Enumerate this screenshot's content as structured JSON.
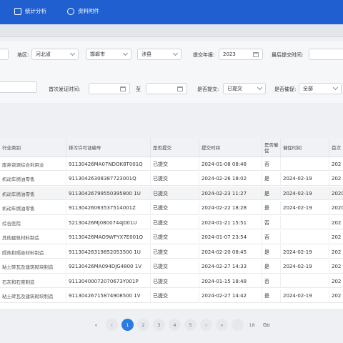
{
  "nav": [
    {
      "label": "统计分析",
      "icon": "chart-icon"
    },
    {
      "label": "资料附件",
      "icon": "attachment-icon"
    }
  ],
  "filters": {
    "region_label": "地区:",
    "province": "河北省",
    "city": "邯郸市",
    "county": "涉县",
    "submit_year_label": "提交年报:",
    "submit_year": "2023",
    "last_submit_label": "最后提交时间:",
    "issue_date_label": "首次发证时间:",
    "to_label": "至",
    "submitted_label": "是否提交:",
    "submitted_value": "已提交",
    "urged_label": "是否催促:",
    "urged_value": "全部"
  },
  "table": {
    "headers": [
      "行业类别",
      "排污许可证编号",
      "是否提交",
      "提交时间",
      "是否催促",
      "催促时间",
      "首次"
    ],
    "rows": [
      [
        "废弃资源综合利用业",
        "91130426MA07NDOK8T001Q",
        "已提交",
        "2024-01-08 08:48",
        "否",
        "",
        "202"
      ],
      [
        "机动车燃油零售",
        "91130426308387723001Q",
        "已提交",
        "2024-02-26 18:02",
        "是",
        "2024-02-19",
        "202"
      ],
      [
        "机动车燃油零售",
        "91130426799550395800 1U",
        "已提交",
        "2024-02-23 11:27",
        "是",
        "2024-02-19",
        "2020"
      ],
      [
        "机动车燃油零售",
        "91130426063537514001Z",
        "已提交",
        "2024-02-22 18:28",
        "是",
        "2024-02-19",
        "2020"
      ],
      [
        "综合医院",
        "52130426MJ0800744J001U",
        "已提交",
        "2024-01-21 15:51",
        "否",
        "",
        "202"
      ],
      [
        "其他建筑材料制造",
        "91130426MAO9WFYX7E001Q",
        "已提交",
        "2024-01-07 23:54",
        "否",
        "",
        "202"
      ],
      [
        "隔热和隔音材料制造",
        "91130426319852053500 1U",
        "已提交",
        "2024-02-20 08:45",
        "是",
        "2024-02-19",
        "202"
      ],
      [
        "粘土砖瓦及建筑砌块制造",
        "92130426MA094DJG4800 1V",
        "已提交",
        "2024-02-27 14:33",
        "是",
        "2024-02-19",
        "202"
      ],
      [
        "石灰和石膏制造",
        "91130400072070673Y001P",
        "已提交",
        "2024-01-15 18:48",
        "否",
        "",
        "202"
      ],
      [
        "粘土砖瓦及建筑砌块制造",
        "91130426715874908500 1V",
        "已提交",
        "2024-02-27 14:42",
        "是",
        "2024-02-19",
        "202"
      ]
    ]
  },
  "pager": {
    "prev2": "«",
    "prev": "‹",
    "pages": [
      "1",
      "2",
      "3",
      "4",
      "5"
    ],
    "next": "›",
    "next2": "»",
    "last": "18",
    "go": "Go"
  }
}
